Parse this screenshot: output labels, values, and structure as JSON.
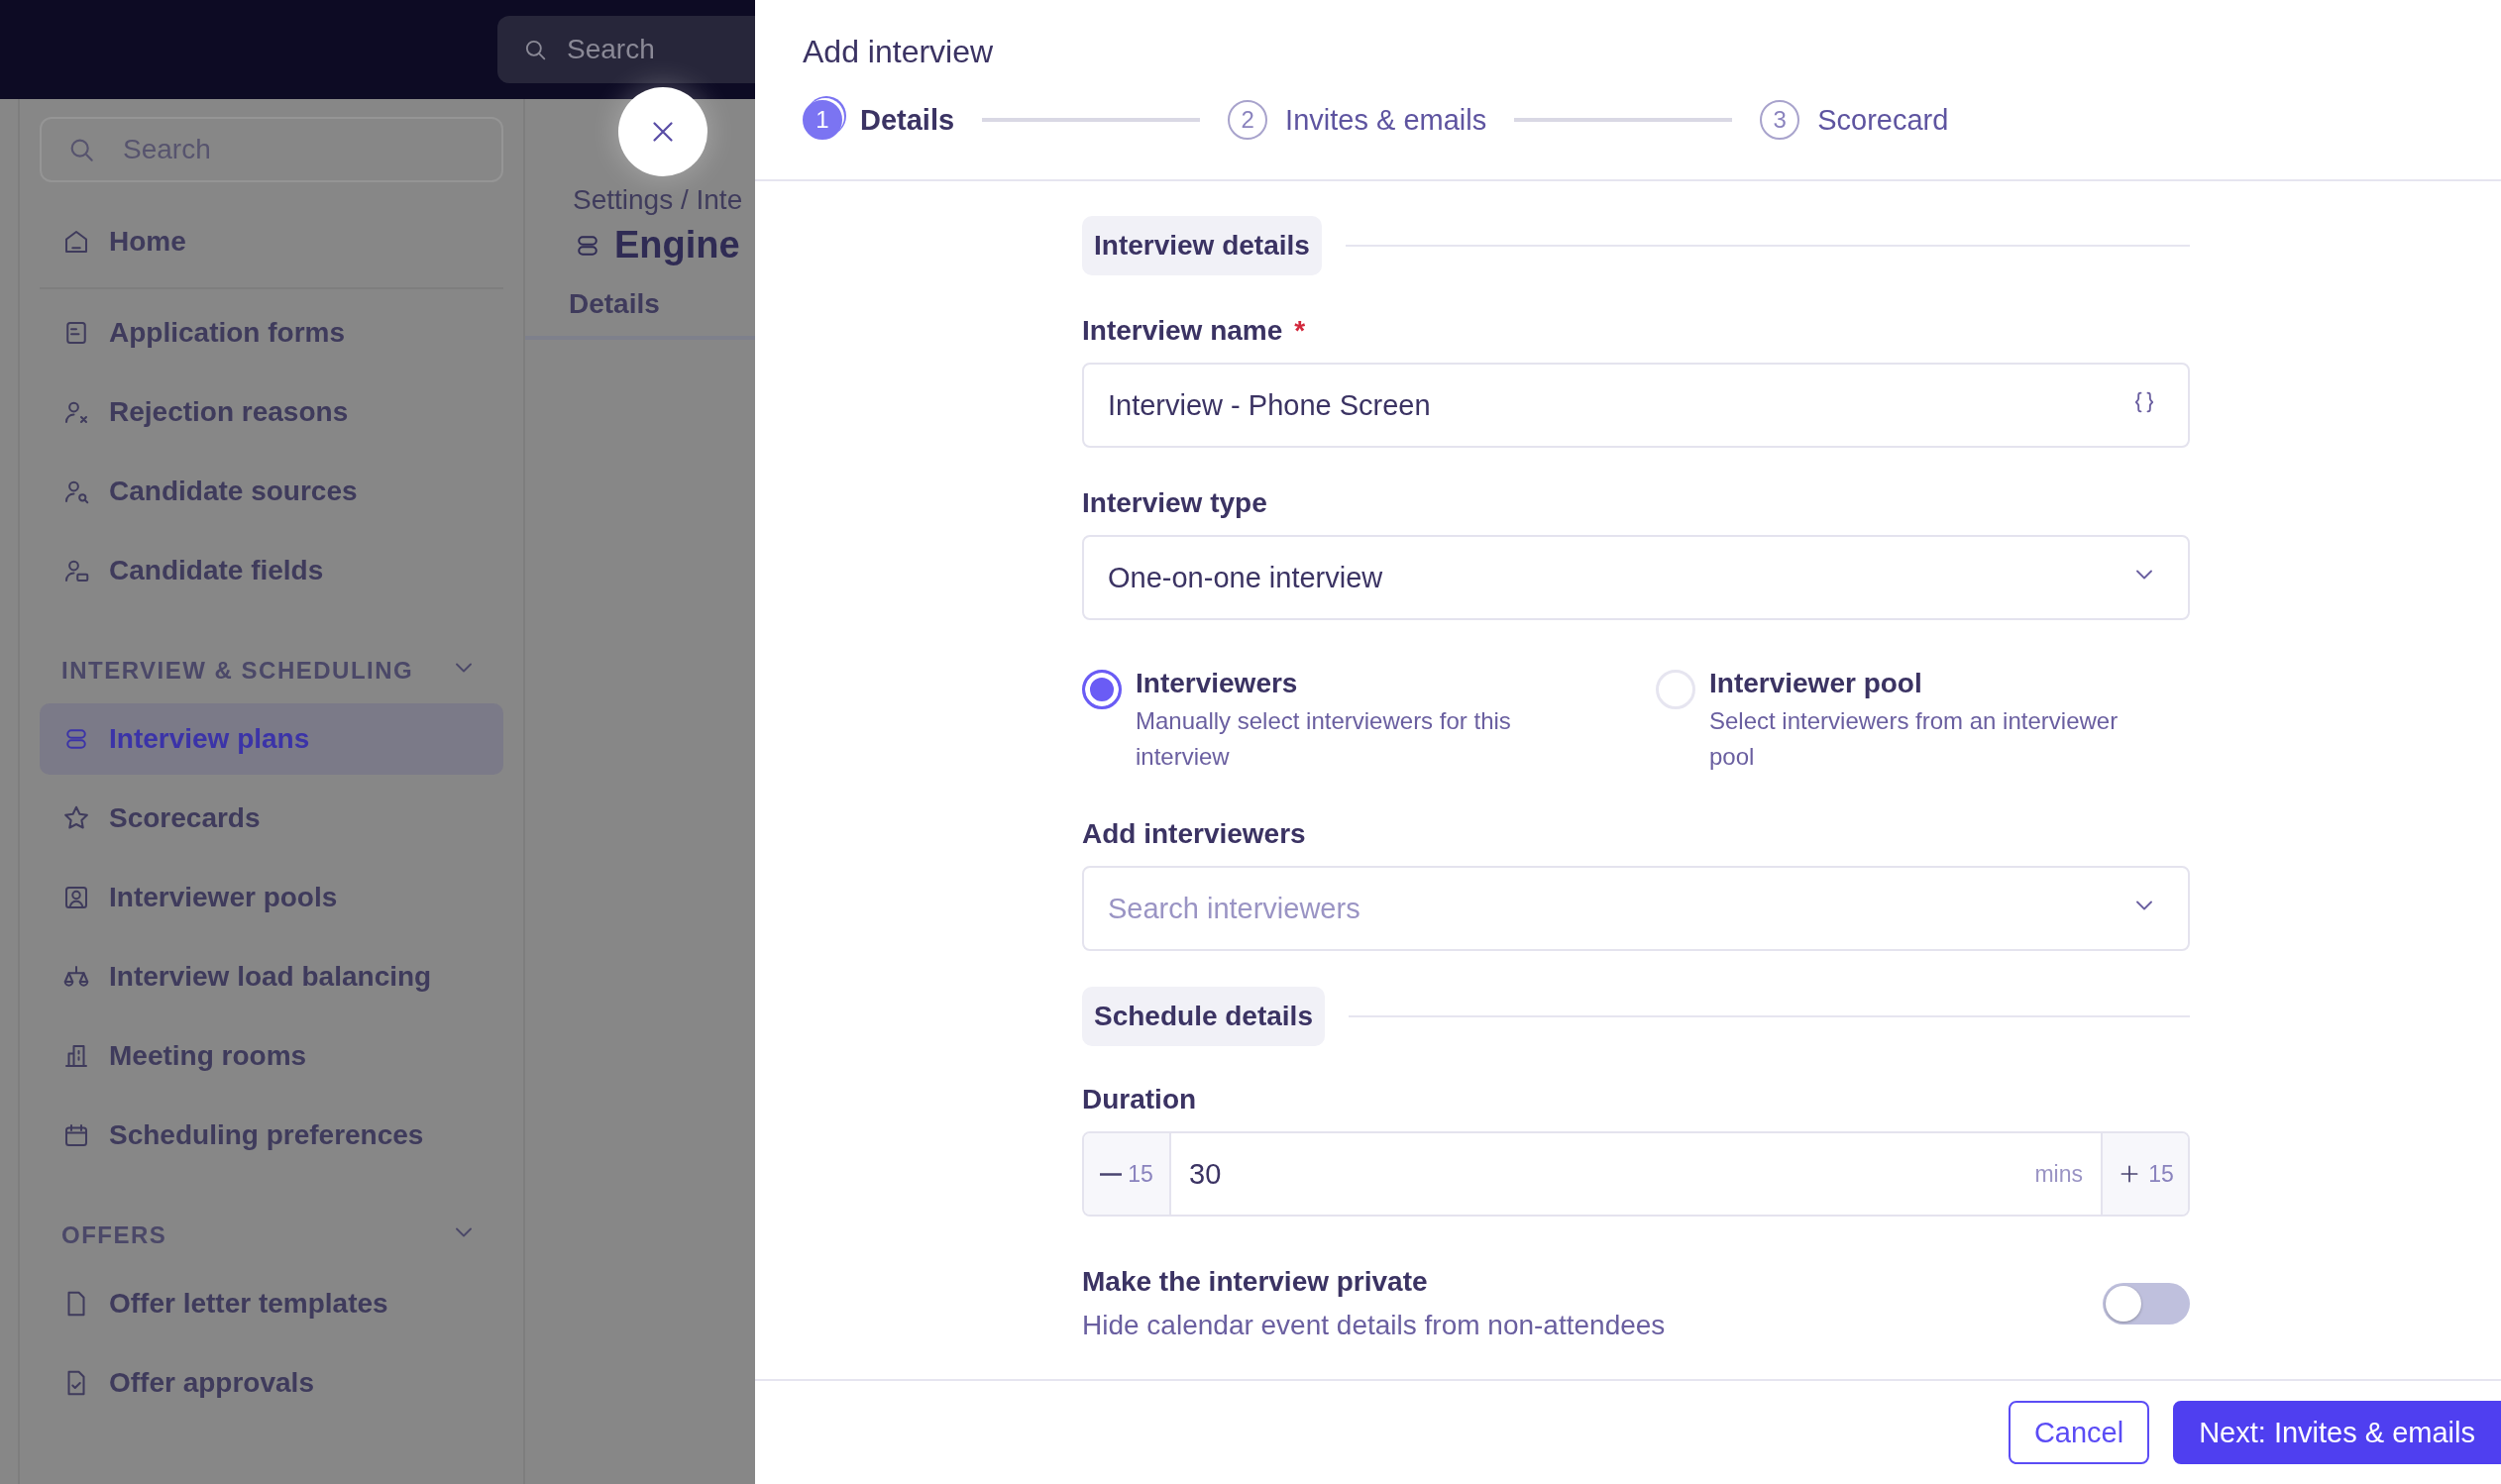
{
  "topbar": {
    "search": {
      "placeholder": "Search"
    }
  },
  "sidebar": {
    "search": {
      "placeholder": "Search"
    },
    "home": [
      {
        "label": "Home",
        "selected": false
      }
    ],
    "groups": [
      {
        "items": [
          {
            "label": "Application forms",
            "selected": false
          },
          {
            "label": "Rejection reasons",
            "selected": false
          },
          {
            "label": "Candidate sources",
            "selected": false
          },
          {
            "label": "Candidate fields",
            "selected": false
          }
        ]
      },
      {
        "title": "INTERVIEW & SCHEDULING",
        "expanded": true,
        "items": [
          {
            "label": "Interview plans",
            "selected": true
          },
          {
            "label": "Scorecards",
            "selected": false
          },
          {
            "label": "Interviewer pools",
            "selected": false
          },
          {
            "label": "Interview load balancing",
            "selected": false
          },
          {
            "label": "Meeting rooms",
            "selected": false
          },
          {
            "label": "Scheduling preferences",
            "selected": false
          }
        ]
      },
      {
        "title": "OFFERS",
        "expanded": true,
        "items": [
          {
            "label": "Offer letter templates",
            "selected": false
          },
          {
            "label": "Offer approvals",
            "selected": false
          }
        ]
      }
    ]
  },
  "page": {
    "breadcrumb": "Settings / Inte",
    "title": "Engine",
    "tabs": [
      {
        "label": "Details",
        "selected": false
      }
    ]
  },
  "dialog": {
    "title": "Add interview",
    "steps": [
      {
        "number": "1",
        "label": "Details",
        "selected": true
      },
      {
        "number": "2",
        "label": "Invites & emails",
        "selected": false
      },
      {
        "number": "3",
        "label": "Scorecard",
        "selected": false
      }
    ],
    "interview_details_heading": "Interview details",
    "name_field": {
      "label": "Interview name",
      "required_mark": "*",
      "value": "Interview - Phone Screen"
    },
    "type_field": {
      "label": "Interview type",
      "value": "One-on-one interview"
    },
    "interviewer_modes": [
      {
        "title": "Interviewers",
        "description": "Manually select interviewers for this interview",
        "selected": true
      },
      {
        "title": "Interviewer pool",
        "description": "Select interviewers from an interviewer pool",
        "selected": false
      }
    ],
    "interviewers_field": {
      "label": "Add interviewers",
      "placeholder": "Search interviewers"
    },
    "schedule_heading": "Schedule details",
    "duration": {
      "label": "Duration",
      "decrement": "15",
      "value": "30",
      "unit": "mins",
      "increment": "15"
    },
    "private": {
      "title": "Make the interview private",
      "description": "Hide calendar event details from non-attendees",
      "on": false
    },
    "buttons": [
      {
        "label": "Cancel",
        "kind": "secondary"
      },
      {
        "label": "Next: Invites & emails",
        "kind": "primary"
      }
    ]
  }
}
